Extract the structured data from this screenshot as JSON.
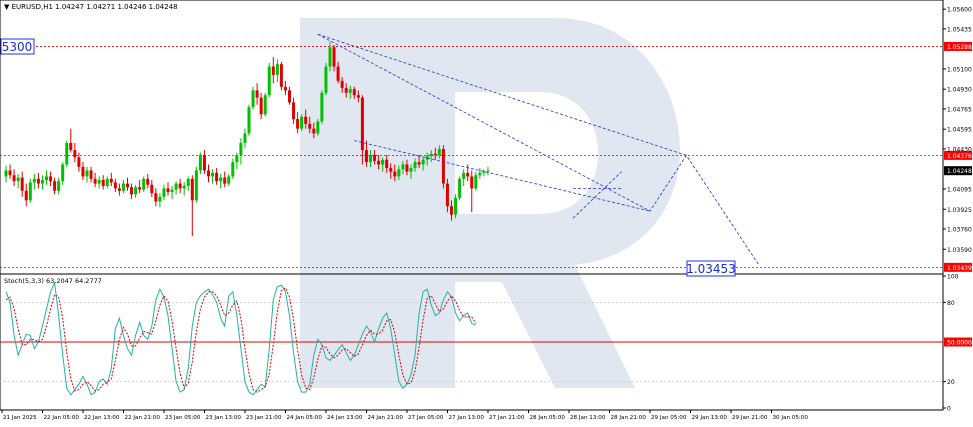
{
  "header": {
    "symbol_line": "EURUSD,H1  1.04247 1.04271 1.04246 1.04248"
  },
  "colors": {
    "bull": "#00c000",
    "bear": "#e00000",
    "level": "#e00000",
    "projection": "#2233dd",
    "stoch_main": "#20b2aa",
    "stoch_signal": "#e00000",
    "watermark": "#c8d4e6",
    "grid": "#c8c8c8",
    "current_price_box": "#000000",
    "level_label_box": "#ff0000"
  },
  "price_labels": {
    "left_level": "5300",
    "target": "1.03453"
  },
  "chart_data": [
    {
      "type": "candlestick",
      "title": "EURUSD,H1",
      "ohlc_caption": "1.04247 1.04271 1.04246 1.04248",
      "ylim": [
        1.034,
        1.0566
      ],
      "y_ticks": [
        "1.05600",
        "1.05435",
        "1.05100",
        "1.04930",
        "1.04765",
        "1.04595",
        "1.04430",
        "1.04095",
        "1.03925",
        "1.03760",
        "1.03590"
      ],
      "y_tick_values": [
        1.056,
        1.05435,
        1.051,
        1.0493,
        1.04765,
        1.04595,
        1.0443,
        1.04095,
        1.03925,
        1.0376,
        1.0359
      ],
      "x_ticks": [
        "21 Jan 2025",
        "22 Jan 05:00",
        "22 Jan 13:00",
        "22 Jan 21:00",
        "23 Jan 05:00",
        "23 Jan 13:00",
        "23 Jan 21:00",
        "24 Jan 05:00",
        "24 Jan 13:00",
        "24 Jan 21:00",
        "27 Jan 05:00",
        "27 Jan 13:00",
        "27 Jan 21:00",
        "28 Jan 05:00",
        "28 Jan 13:00",
        "28 Jan 21:00",
        "29 Jan 05:00",
        "29 Jan 13:00",
        "29 Jan 21:00",
        "30 Jan 05:00"
      ],
      "x_tick_bar_index": [
        0,
        10,
        20,
        30,
        40,
        50,
        60,
        70,
        80,
        90,
        100,
        110,
        120,
        130,
        140,
        150,
        160,
        170,
        180,
        190
      ],
      "horizontal_levels": [
        {
          "label": "1.05288",
          "value": 1.05288
        },
        {
          "label": "1.04376",
          "value": 1.04376
        },
        {
          "label": "1.03439",
          "value": 1.03439
        }
      ],
      "current_price": {
        "label": "1.04248",
        "value": 1.04248
      },
      "candles": [
        [
          1.042,
          1.0429,
          1.0415,
          1.0425
        ],
        [
          1.0425,
          1.043,
          1.0418,
          1.0421
        ],
        [
          1.0421,
          1.0426,
          1.0412,
          1.0416
        ],
        [
          1.0416,
          1.0422,
          1.041,
          1.0419
        ],
        [
          1.0419,
          1.0424,
          1.0403,
          1.0408
        ],
        [
          1.0408,
          1.0414,
          1.0395,
          1.04
        ],
        [
          1.04,
          1.0418,
          1.0398,
          1.0415
        ],
        [
          1.0415,
          1.0422,
          1.0409,
          1.0418
        ],
        [
          1.0418,
          1.0423,
          1.041,
          1.0414
        ],
        [
          1.0414,
          1.0421,
          1.0409,
          1.0417
        ],
        [
          1.0417,
          1.0425,
          1.0413,
          1.042
        ],
        [
          1.042,
          1.0424,
          1.0412,
          1.0416
        ],
        [
          1.0416,
          1.0419,
          1.0405,
          1.0408
        ],
        [
          1.0408,
          1.0419,
          1.0405,
          1.0416
        ],
        [
          1.0416,
          1.0432,
          1.0413,
          1.043
        ],
        [
          1.043,
          1.045,
          1.0428,
          1.0448
        ],
        [
          1.0448,
          1.046,
          1.044,
          1.0442
        ],
        [
          1.0442,
          1.0448,
          1.0432,
          1.0436
        ],
        [
          1.0436,
          1.044,
          1.0424,
          1.0428
        ],
        [
          1.0428,
          1.0432,
          1.0417,
          1.042
        ],
        [
          1.042,
          1.0428,
          1.0415,
          1.0425
        ],
        [
          1.0425,
          1.0428,
          1.0415,
          1.0418
        ],
        [
          1.0418,
          1.0423,
          1.0411,
          1.0414
        ],
        [
          1.0414,
          1.042,
          1.041,
          1.0417
        ],
        [
          1.0417,
          1.0421,
          1.0409,
          1.0412
        ],
        [
          1.0412,
          1.042,
          1.041,
          1.0418
        ],
        [
          1.0418,
          1.0423,
          1.0412,
          1.0415
        ],
        [
          1.0415,
          1.0418,
          1.0407,
          1.041
        ],
        [
          1.041,
          1.0414,
          1.0404,
          1.0408
        ],
        [
          1.0408,
          1.0417,
          1.0406,
          1.0414
        ],
        [
          1.0414,
          1.0419,
          1.0408,
          1.0411
        ],
        [
          1.0411,
          1.0414,
          1.0401,
          1.0405
        ],
        [
          1.0405,
          1.0413,
          1.0402,
          1.0411
        ],
        [
          1.0411,
          1.0417,
          1.0406,
          1.0409
        ],
        [
          1.0409,
          1.042,
          1.0407,
          1.0418
        ],
        [
          1.0418,
          1.0422,
          1.041,
          1.0413
        ],
        [
          1.0413,
          1.0417,
          1.0403,
          1.0406
        ],
        [
          1.0406,
          1.041,
          1.0395,
          1.0399
        ],
        [
          1.0399,
          1.0406,
          1.0394,
          1.0403
        ],
        [
          1.0403,
          1.0413,
          1.04,
          1.041
        ],
        [
          1.041,
          1.0415,
          1.0404,
          1.0407
        ],
        [
          1.0407,
          1.0412,
          1.0401,
          1.0409
        ],
        [
          1.0409,
          1.0416,
          1.0405,
          1.0414
        ],
        [
          1.0414,
          1.0418,
          1.0406,
          1.041
        ],
        [
          1.041,
          1.0415,
          1.0404,
          1.0412
        ],
        [
          1.0412,
          1.042,
          1.0408,
          1.0418
        ],
        [
          1.0418,
          1.0421,
          1.037,
          1.04
        ],
        [
          1.04,
          1.0428,
          1.0398,
          1.0425
        ],
        [
          1.0425,
          1.044,
          1.0422,
          1.0438
        ],
        [
          1.0438,
          1.0442,
          1.0422,
          1.0425
        ],
        [
          1.0425,
          1.043,
          1.0415,
          1.042
        ],
        [
          1.042,
          1.0426,
          1.0414,
          1.0423
        ],
        [
          1.0423,
          1.0427,
          1.0413,
          1.0416
        ],
        [
          1.0416,
          1.0422,
          1.041,
          1.0419
        ],
        [
          1.0419,
          1.0424,
          1.0411,
          1.0414
        ],
        [
          1.0414,
          1.0422,
          1.0412,
          1.042
        ],
        [
          1.042,
          1.0435,
          1.0418,
          1.0432
        ],
        [
          1.0432,
          1.044,
          1.0426,
          1.0438
        ],
        [
          1.0438,
          1.0452,
          1.043,
          1.0448
        ],
        [
          1.0448,
          1.046,
          1.0444,
          1.0456
        ],
        [
          1.0456,
          1.048,
          1.0454,
          1.0478
        ],
        [
          1.0478,
          1.0495,
          1.0476,
          1.0492
        ],
        [
          1.0492,
          1.0498,
          1.048,
          1.0486
        ],
        [
          1.0486,
          1.049,
          1.0468,
          1.0472
        ],
        [
          1.0472,
          1.049,
          1.047,
          1.0488
        ],
        [
          1.0488,
          1.0515,
          1.0486,
          1.0512
        ],
        [
          1.0512,
          1.052,
          1.0498,
          1.0505
        ],
        [
          1.0505,
          1.0518,
          1.0499,
          1.0514
        ],
        [
          1.0514,
          1.0516,
          1.0492,
          1.0495
        ],
        [
          1.0495,
          1.05,
          1.0488,
          1.0492
        ],
        [
          1.0492,
          1.0495,
          1.048,
          1.0482
        ],
        [
          1.0482,
          1.0486,
          1.0464,
          1.0468
        ],
        [
          1.0468,
          1.0474,
          1.0456,
          1.046
        ],
        [
          1.046,
          1.0472,
          1.0458,
          1.047
        ],
        [
          1.047,
          1.0476,
          1.046,
          1.0464
        ],
        [
          1.0464,
          1.047,
          1.0456,
          1.046
        ],
        [
          1.046,
          1.0465,
          1.0452,
          1.0456
        ],
        [
          1.0456,
          1.0468,
          1.0454,
          1.0466
        ],
        [
          1.0466,
          1.0492,
          1.0464,
          1.049
        ],
        [
          1.049,
          1.0515,
          1.0488,
          1.0512
        ],
        [
          1.0512,
          1.0533,
          1.0508,
          1.0528
        ],
        [
          1.0528,
          1.053,
          1.0508,
          1.0512
        ],
        [
          1.0512,
          1.0516,
          1.0498,
          1.05
        ],
        [
          1.05,
          1.0503,
          1.049,
          1.0494
        ],
        [
          1.0494,
          1.0498,
          1.0486,
          1.049
        ],
        [
          1.049,
          1.0496,
          1.0485,
          1.0493
        ],
        [
          1.0493,
          1.0495,
          1.0485,
          1.0488
        ],
        [
          1.0488,
          1.0492,
          1.0482,
          1.0486
        ],
        [
          1.0486,
          1.0488,
          1.043,
          1.0442
        ],
        [
          1.0442,
          1.045,
          1.0428,
          1.0432
        ],
        [
          1.0432,
          1.0442,
          1.0428,
          1.0438
        ],
        [
          1.0438,
          1.0442,
          1.043,
          1.0433
        ],
        [
          1.0433,
          1.0438,
          1.0426,
          1.043
        ],
        [
          1.043,
          1.0436,
          1.0424,
          1.0434
        ],
        [
          1.0434,
          1.0438,
          1.0423,
          1.0427
        ],
        [
          1.0427,
          1.0431,
          1.0418,
          1.0424
        ],
        [
          1.0424,
          1.043,
          1.0416,
          1.042
        ],
        [
          1.042,
          1.0429,
          1.0417,
          1.0426
        ],
        [
          1.0426,
          1.0433,
          1.0422,
          1.043
        ],
        [
          1.043,
          1.0434,
          1.0421,
          1.0424
        ],
        [
          1.0424,
          1.043,
          1.0418,
          1.0427
        ],
        [
          1.0427,
          1.0435,
          1.0424,
          1.0432
        ],
        [
          1.0432,
          1.0438,
          1.0427,
          1.043
        ],
        [
          1.043,
          1.0436,
          1.0425,
          1.0434
        ],
        [
          1.0434,
          1.044,
          1.0429,
          1.0437
        ],
        [
          1.0437,
          1.0442,
          1.0432,
          1.0439
        ],
        [
          1.0439,
          1.0444,
          1.0434,
          1.0438
        ],
        [
          1.0438,
          1.0446,
          1.0435,
          1.0443
        ],
        [
          1.0443,
          1.0446,
          1.041,
          1.0414
        ],
        [
          1.0414,
          1.0418,
          1.039,
          1.0395
        ],
        [
          1.0395,
          1.04,
          1.0383,
          1.0388
        ],
        [
          1.0388,
          1.0405,
          1.0385,
          1.0402
        ],
        [
          1.0402,
          1.042,
          1.04,
          1.0418
        ],
        [
          1.0418,
          1.0426,
          1.0412,
          1.0423
        ],
        [
          1.0423,
          1.043,
          1.0416,
          1.042
        ],
        [
          1.042,
          1.0425,
          1.039,
          1.041
        ],
        [
          1.041,
          1.0424,
          1.0408,
          1.0421
        ],
        [
          1.0421,
          1.0427,
          1.0418,
          1.0423
        ],
        [
          1.0423,
          1.0426,
          1.042,
          1.0424
        ],
        [
          1.0424,
          1.0428,
          1.0421,
          1.04248
        ]
      ],
      "projection_path": [
        [
          77,
          1.0539
        ],
        [
          159,
          1.0391
        ],
        [
          168,
          1.04376
        ],
        [
          186,
          1.03453
        ]
      ],
      "channel_upper": [
        [
          77,
          1.0539
        ],
        [
          168,
          1.04376
        ]
      ],
      "channel_lower": [
        [
          86,
          1.045
        ],
        [
          159,
          1.0391
        ]
      ],
      "local_trend_upper": [
        [
          140,
          1.0385
        ],
        [
          152,
          1.0424
        ]
      ],
      "local_trend_lower": [
        [
          140,
          1.041
        ],
        [
          152,
          1.041
        ]
      ]
    },
    {
      "type": "line",
      "title": "Stoch(5,3,3) 63.2047 64.2777",
      "ylim": [
        0,
        100
      ],
      "y_ticks": [
        "100",
        "80",
        "50.0000",
        "20",
        "0"
      ],
      "y_tick_values": [
        100,
        80,
        50,
        20,
        0
      ],
      "level": {
        "label": "50.0000",
        "value": 50
      },
      "series": [
        {
          "name": "Stoch main 63.2047",
          "values": [
            88,
            80,
            55,
            40,
            48,
            56,
            55,
            45,
            50,
            62,
            75,
            88,
            95,
            70,
            40,
            15,
            10,
            14,
            18,
            24,
            18,
            10,
            12,
            20,
            22,
            18,
            30,
            60,
            68,
            55,
            45,
            40,
            55,
            65,
            55,
            52,
            62,
            82,
            90,
            84,
            70,
            45,
            20,
            12,
            14,
            30,
            62,
            80,
            85,
            88,
            90,
            86,
            80,
            68,
            62,
            85,
            88,
            70,
            45,
            20,
            12,
            10,
            14,
            18,
            16,
            45,
            82,
            92,
            93,
            88,
            70,
            42,
            20,
            12,
            12,
            18,
            40,
            52,
            48,
            38,
            36,
            40,
            44,
            48,
            42,
            36,
            40,
            48,
            56,
            62,
            58,
            50,
            60,
            68,
            72,
            60,
            40,
            20,
            15,
            18,
            25,
            40,
            72,
            88,
            90,
            78,
            70,
            72,
            82,
            88,
            84,
            72,
            66,
            70,
            72,
            64,
            63
          ]
        },
        {
          "name": "Stoch signal 64.2777",
          "values": [
            82,
            84,
            75,
            60,
            48,
            48,
            52,
            52,
            50,
            52,
            62,
            75,
            86,
            84,
            68,
            42,
            22,
            13,
            14,
            18,
            20,
            17,
            13,
            14,
            18,
            20,
            22,
            36,
            52,
            61,
            56,
            47,
            47,
            53,
            58,
            57,
            56,
            66,
            78,
            85,
            81,
            66,
            45,
            26,
            15,
            19,
            35,
            58,
            75,
            84,
            88,
            88,
            85,
            78,
            70,
            72,
            78,
            81,
            68,
            45,
            26,
            14,
            12,
            14,
            16,
            26,
            48,
            73,
            89,
            91,
            84,
            67,
            44,
            25,
            15,
            14,
            23,
            37,
            47,
            46,
            41,
            38,
            40,
            44,
            45,
            42,
            39,
            41,
            48,
            55,
            59,
            56,
            56,
            59,
            66,
            67,
            57,
            40,
            25,
            18,
            19,
            28,
            46,
            67,
            83,
            85,
            79,
            73,
            75,
            81,
            85,
            81,
            74,
            69,
            69,
            69,
            64.28
          ]
        }
      ]
    }
  ]
}
